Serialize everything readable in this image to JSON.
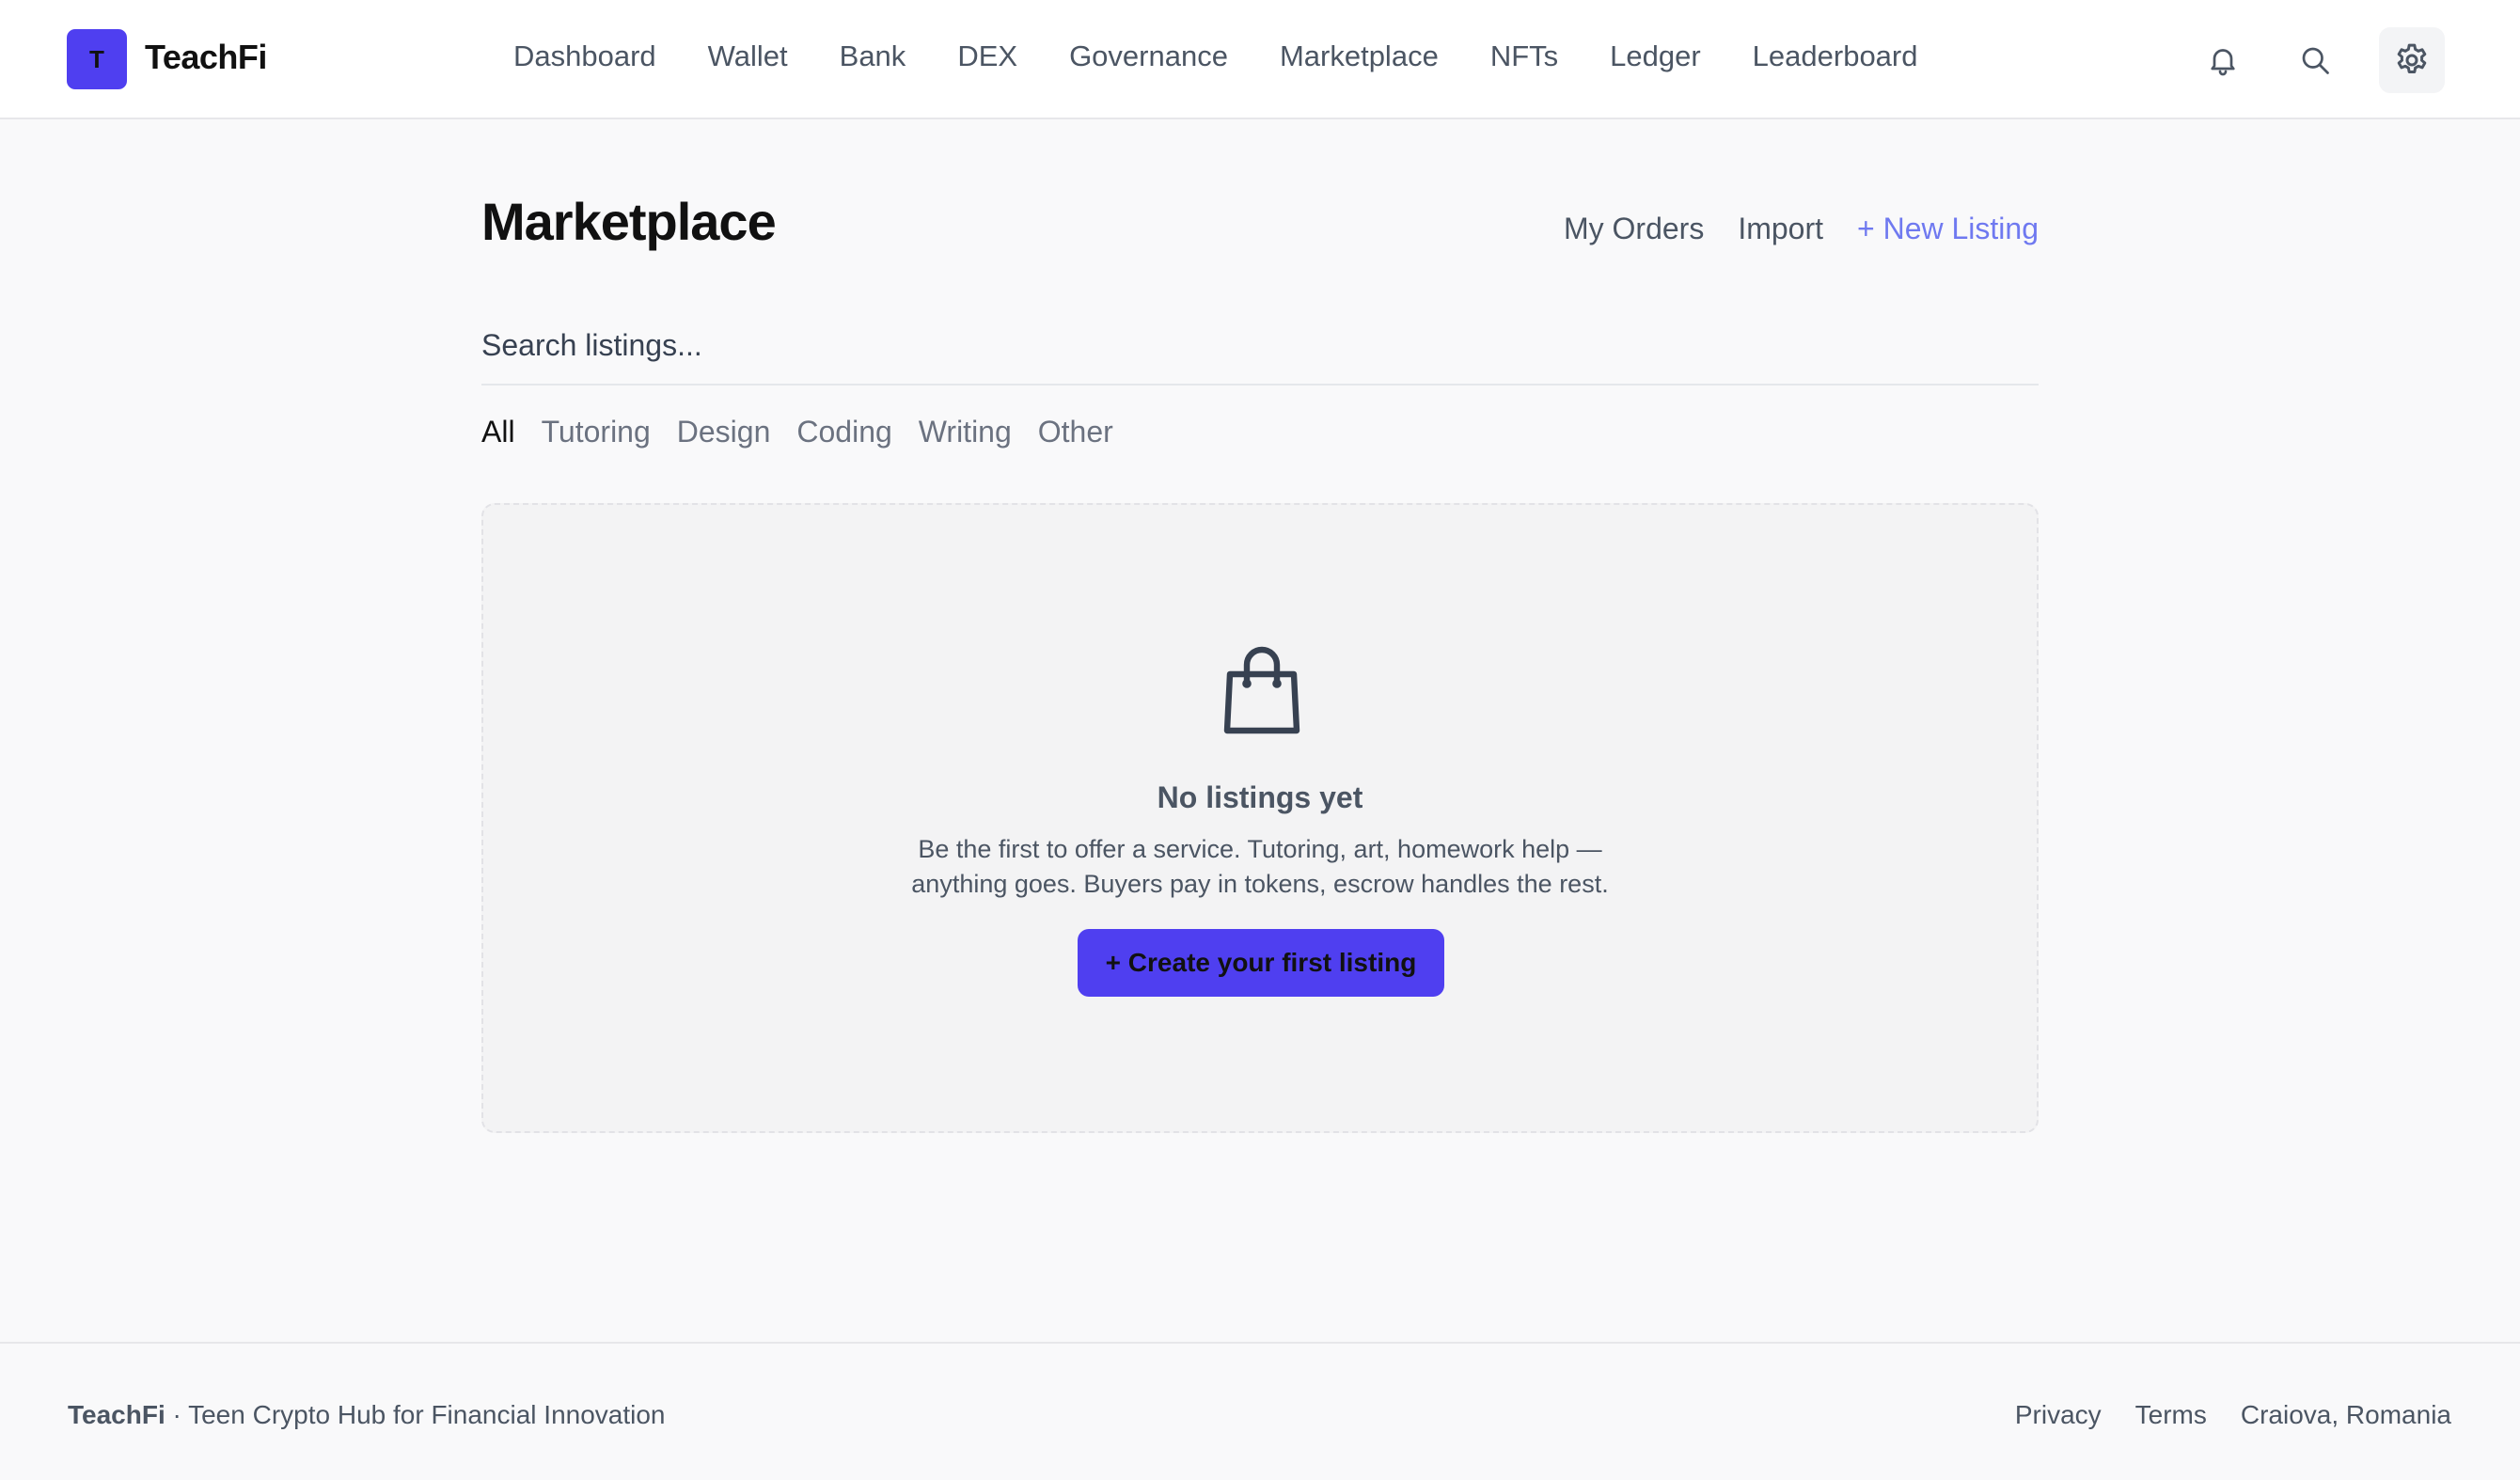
{
  "header": {
    "logo_letter": "T",
    "brand": "TeachFi",
    "nav": [
      "Dashboard",
      "Wallet",
      "Bank",
      "DEX",
      "Governance",
      "Marketplace",
      "NFTs",
      "Ledger",
      "Leaderboard"
    ],
    "icons": [
      "bell-icon",
      "search-icon",
      "gear-icon"
    ]
  },
  "main": {
    "title": "Marketplace",
    "actions": {
      "my_orders": "My Orders",
      "import": "Import",
      "new_listing": "+ New Listing"
    },
    "search": {
      "placeholder": "Search listings...",
      "value": ""
    },
    "filters": [
      "All",
      "Tutoring",
      "Design",
      "Coding",
      "Writing",
      "Other"
    ],
    "active_filter": "All",
    "empty": {
      "icon": "shopping-bag-icon",
      "title": "No listings yet",
      "desc_line1": "Be the first to offer a service. Tutoring, art, homework help —",
      "desc_line2": "anything goes. Buyers pay in tokens, escrow handles the rest.",
      "cta": "+ Create your first listing"
    }
  },
  "footer": {
    "brand": "TeachFi",
    "tagline": " · Teen Crypto Hub for Financial Innovation",
    "links": {
      "privacy": "Privacy",
      "terms": "Terms"
    },
    "location": "Craiova, Romania"
  },
  "colors": {
    "accent": "#4f3ff0",
    "link_primary": "#6f79f0",
    "text_muted": "#4b5563",
    "background": "#f9f9fa"
  }
}
